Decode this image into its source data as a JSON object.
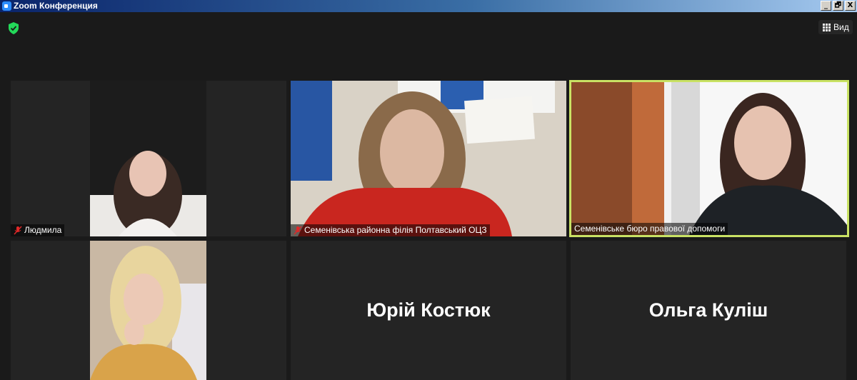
{
  "window": {
    "title": "Zoom Конференция",
    "buttons": [
      "_",
      "🗗",
      "X"
    ]
  },
  "toolbar": {
    "view_label": "Вид"
  },
  "participants": [
    {
      "name": "Людмила",
      "muted": true
    },
    {
      "name": "Семенівська районна філія Полтавський ОЦЗ",
      "muted": true
    },
    {
      "name": "Семенівське бюро правової допомоги",
      "muted": false,
      "active_speaker": true
    },
    {
      "name": ""
    },
    {
      "name": "Юрій Костюк"
    },
    {
      "name": "Ольга Куліш"
    }
  ],
  "colors": {
    "active_border": "#c9e264",
    "mute_icon": "#e02828",
    "secure_shield": "#23d959"
  }
}
